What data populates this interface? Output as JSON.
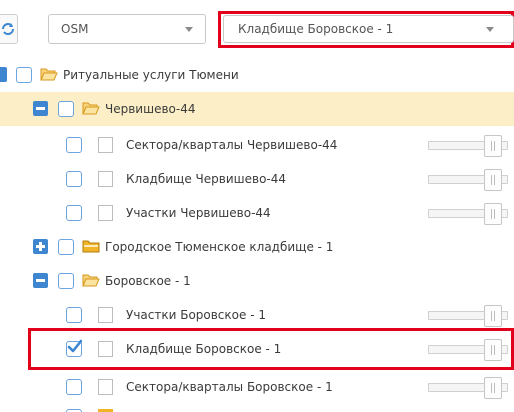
{
  "toolbar": {
    "base_layer_select": {
      "value": "OSM"
    },
    "cemetery_select": {
      "value": "Кладбище Боровское - 1"
    }
  },
  "tree": {
    "root": {
      "label": "Ритуальные услуги Тюмени"
    },
    "groups": [
      {
        "label": "Червишево-44",
        "expanded": true,
        "items": [
          {
            "label": "Сектора/кварталы Червишево-44",
            "checked": false
          },
          {
            "label": "Кладбище Червишево-44",
            "checked": false
          },
          {
            "label": "Участки Червишево-44",
            "checked": false
          }
        ]
      },
      {
        "label": "Городское Тюменское кладбище - 1",
        "expanded": false,
        "items": []
      },
      {
        "label": "Боровское - 1",
        "expanded": true,
        "items": [
          {
            "label": "Участки Боровское - 1",
            "checked": false
          },
          {
            "label": "Кладбище Боровское - 1",
            "checked": true
          },
          {
            "label": "Сектора/кварталы Боровское - 1",
            "checked": false
          }
        ]
      }
    ]
  },
  "colors": {
    "accent": "#3e86cf",
    "highlight": "#e3001b",
    "selected_row": "#fcefc7",
    "folder": "#f0b429"
  }
}
